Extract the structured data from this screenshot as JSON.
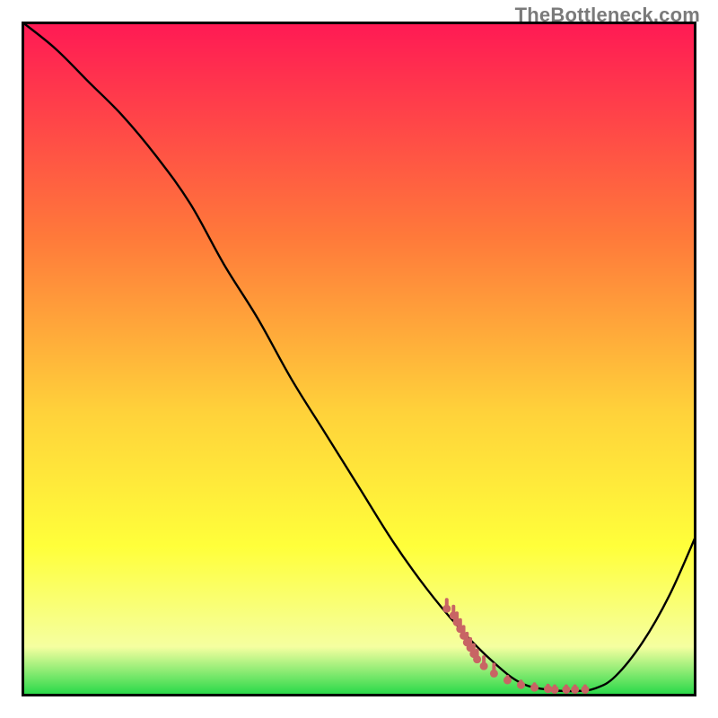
{
  "watermark": {
    "text": "TheBottleneck.com"
  },
  "colors": {
    "frame": "#000000",
    "curve": "#000000",
    "marker": "#c86464",
    "gradient_top": "#ff1a54",
    "gradient_mid1": "#ff7a3a",
    "gradient_mid2": "#ffd23a",
    "gradient_mid3": "#ffff3a",
    "gradient_mid4": "#f5ffa0",
    "gradient_bottom": "#2bd94a"
  },
  "chart_data": {
    "type": "line",
    "title": "",
    "xlabel": "",
    "ylabel": "",
    "xlim": [
      0,
      100
    ],
    "ylim": [
      0,
      100
    ],
    "grid": false,
    "legend": false,
    "annotations": [],
    "series": [
      {
        "name": "curve",
        "x": [
          0,
          5,
          10,
          15,
          20,
          25,
          30,
          35,
          40,
          45,
          50,
          55,
          60,
          65,
          70,
          74,
          78,
          82,
          85,
          88,
          92,
          96,
          100
        ],
        "y": [
          100,
          96,
          91,
          86,
          80,
          73,
          64,
          56,
          47,
          39,
          31,
          23,
          16,
          10,
          5,
          2,
          1,
          0.8,
          1.2,
          3,
          8,
          15,
          24
        ]
      }
    ],
    "marker_points": {
      "name": "optimal-range",
      "x": [
        63,
        64,
        64.5,
        65,
        65.5,
        66,
        66.5,
        67,
        67.5,
        68.5,
        70,
        72,
        74,
        76,
        78,
        79,
        80.7,
        82,
        83.5
      ],
      "y": [
        13,
        12,
        11,
        10,
        9,
        8,
        7.2,
        6.3,
        5.5,
        4.5,
        3.4,
        2.4,
        1.7,
        1.3,
        1.1,
        1.0,
        1.0,
        1.0,
        1.0
      ]
    }
  }
}
